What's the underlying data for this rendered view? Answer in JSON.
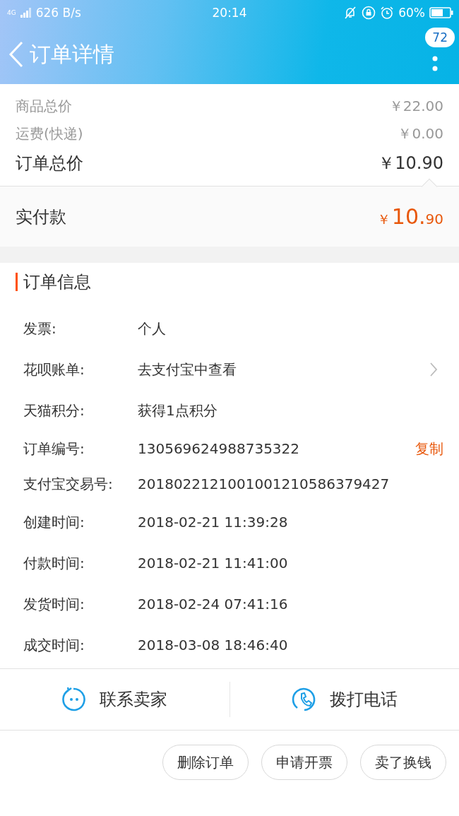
{
  "status_bar": {
    "network": "4G",
    "speed": "626 B/s",
    "time": "20:14",
    "battery": "60%"
  },
  "header": {
    "title": "订单详情",
    "badge": "72"
  },
  "prices": [
    {
      "label": "商品总价",
      "value": "￥22.00",
      "kind": "sub"
    },
    {
      "label": "运费(快递)",
      "value": "￥0.00",
      "kind": "sub"
    },
    {
      "label": "订单总价",
      "value": "￥10.90",
      "kind": "total"
    }
  ],
  "paid": {
    "label": "实付款",
    "currency": "￥",
    "integer": "10.",
    "decimal": "90"
  },
  "order_info": {
    "title": "订单信息",
    "rows": [
      {
        "label": "发票:",
        "value": "个人",
        "kind": "plain"
      },
      {
        "label": "花呗账单:",
        "value": "去支付宝中查看",
        "kind": "link"
      },
      {
        "label": "天猫积分:",
        "value": "获得1点积分",
        "kind": "plain"
      },
      {
        "label": "订单编号:",
        "value": "130569624988735322",
        "kind": "action",
        "action": "复制"
      },
      {
        "label": "支付宝交易号:",
        "value": "2018022121001001210586379427",
        "kind": "plain"
      },
      {
        "label": "创建时间:",
        "value": "2018-02-21 11:39:28",
        "kind": "plain"
      },
      {
        "label": "付款时间:",
        "value": "2018-02-21 11:41:00",
        "kind": "plain"
      },
      {
        "label": "发货时间:",
        "value": "2018-02-24 07:41:16",
        "kind": "plain"
      },
      {
        "label": "成交时间:",
        "value": "2018-03-08 18:46:40",
        "kind": "plain"
      }
    ]
  },
  "contact": [
    {
      "label": "联系卖家",
      "kind": "chat"
    },
    {
      "label": "拨打电话",
      "kind": "phone"
    }
  ],
  "actions": [
    "删除订单",
    "申请开票",
    "卖了换钱"
  ]
}
